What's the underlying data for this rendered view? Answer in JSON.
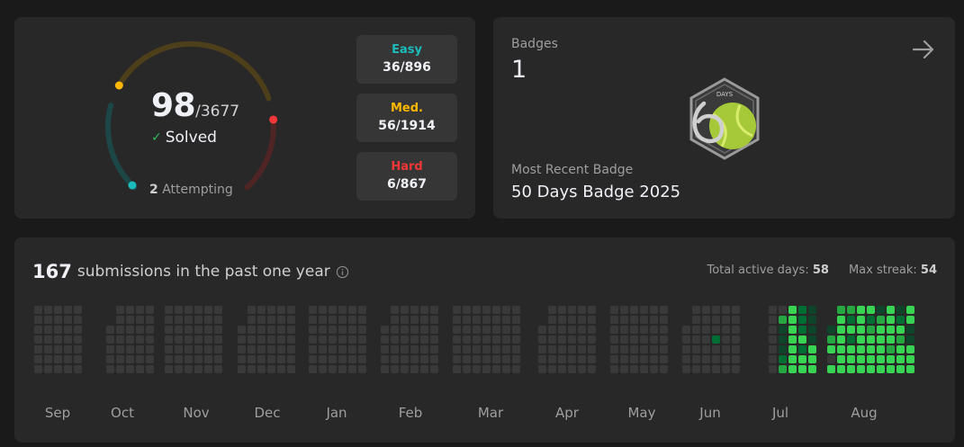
{
  "progress": {
    "solved": "98",
    "total": "/3677",
    "solved_label": "Solved",
    "attempting_count": "2",
    "attempting_label": "Attempting",
    "difficulties": [
      {
        "name": "Easy",
        "value": "36/896",
        "color": "#1cbaba"
      },
      {
        "name": "Med.",
        "value": "56/1914",
        "color": "#ffb700"
      },
      {
        "name": "Hard",
        "value": "6/867",
        "color": "#f63737"
      }
    ]
  },
  "badges": {
    "title": "Badges",
    "count": "1",
    "recent_label": "Most Recent Badge",
    "recent_name": "50 Days Badge 2025",
    "badge_text": "DAYS"
  },
  "submissions": {
    "count": "167",
    "label": "submissions in the past one year",
    "active_days_label": "Total active days:",
    "active_days": "58",
    "max_streak_label": "Max streak:",
    "max_streak": "54",
    "months": [
      "Sep",
      "Oct",
      "Nov",
      "Dec",
      "Jan",
      "Feb",
      "Mar",
      "Apr",
      "May",
      "Jun",
      "Jul",
      "Aug"
    ]
  },
  "colors": {
    "easy": "#1cbaba",
    "medium": "#ffb700",
    "hard": "#f63737",
    "cell_empty": "#393939",
    "green_1": "#0e4429",
    "green_2": "#006d32",
    "green_3": "#26a641",
    "green_4": "#39d353"
  }
}
